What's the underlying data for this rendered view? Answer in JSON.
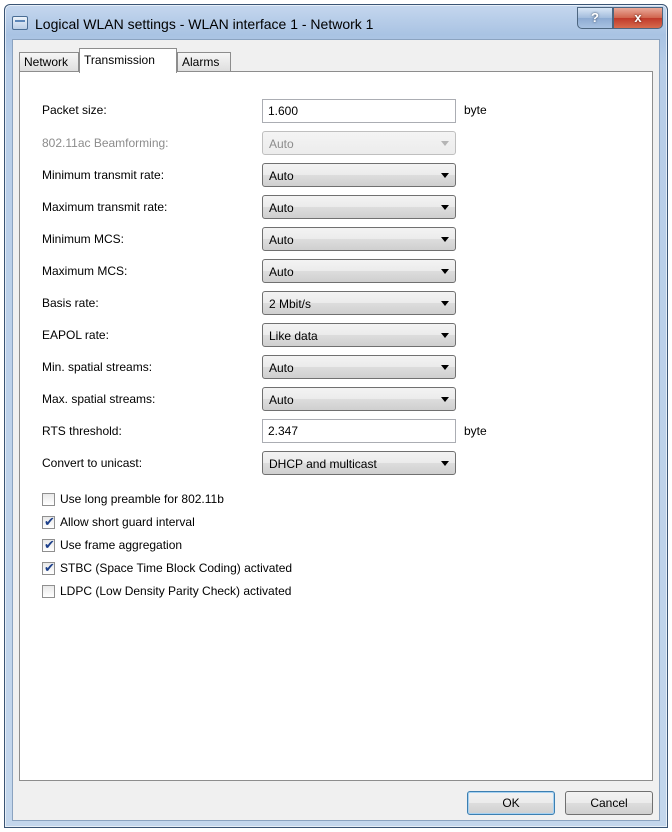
{
  "window": {
    "title": "Logical WLAN settings - WLAN interface 1 - Network 1",
    "help_label": "?",
    "close_label": "x"
  },
  "tabs": [
    {
      "label": "Network"
    },
    {
      "label": "Transmission",
      "active": true
    },
    {
      "label": "Alarms"
    }
  ],
  "fields": {
    "packet_size": {
      "label": "Packet size:",
      "value": "1.600",
      "unit": "byte"
    },
    "beamforming": {
      "label": "802.11ac Beamforming:",
      "value": "Auto"
    },
    "min_transmit_rate": {
      "label": "Minimum transmit rate:",
      "value": "Auto"
    },
    "max_transmit_rate": {
      "label": "Maximum transmit rate:",
      "value": "Auto"
    },
    "min_mcs": {
      "label": "Minimum MCS:",
      "value": "Auto"
    },
    "max_mcs": {
      "label": "Maximum MCS:",
      "value": "Auto"
    },
    "basis_rate": {
      "label": "Basis rate:",
      "value": "2 Mbit/s"
    },
    "eapol_rate": {
      "label": "EAPOL rate:",
      "value": "Like data"
    },
    "min_spatial_streams": {
      "label": "Min. spatial streams:",
      "value": "Auto"
    },
    "max_spatial_streams": {
      "label": "Max. spatial streams:",
      "value": "Auto"
    },
    "rts_threshold": {
      "label": "RTS threshold:",
      "value": "2.347",
      "unit": "byte"
    },
    "convert_unicast": {
      "label": "Convert to unicast:",
      "value": "DHCP and multicast"
    }
  },
  "checkboxes": [
    {
      "label": "Use long preamble for 802.11b",
      "checked": false
    },
    {
      "label": "Allow short guard interval",
      "checked": true
    },
    {
      "label": "Use frame aggregation",
      "checked": true
    },
    {
      "label": "STBC (Space Time Block Coding) activated",
      "checked": true
    },
    {
      "label": "LDPC (Low Density Parity Check) activated",
      "checked": false
    }
  ],
  "check_mark": "✔",
  "buttons": {
    "ok": "OK",
    "cancel": "Cancel"
  }
}
